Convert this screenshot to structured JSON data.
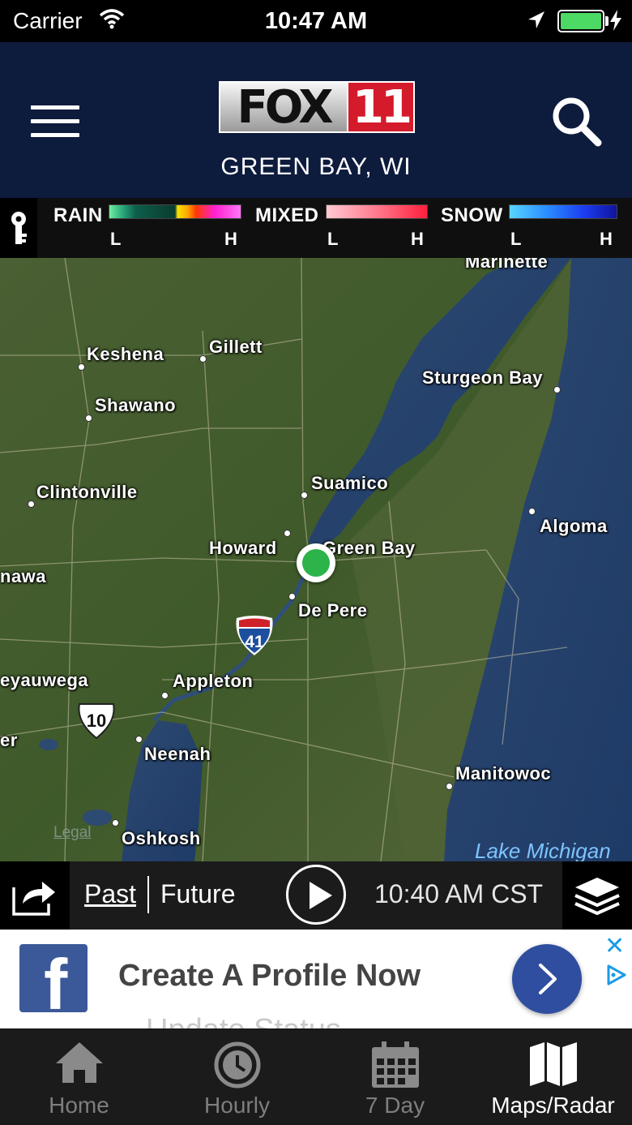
{
  "status_bar": {
    "carrier": "Carrier",
    "time": "10:47 AM",
    "battery_color": "#4cd964"
  },
  "header": {
    "logo_text": "FOX",
    "logo_number": "11",
    "location": "GREEN BAY, WI",
    "background_color": "#0d1b3d",
    "menu_icon": "hamburger-icon",
    "search_icon": "search-icon"
  },
  "legend": {
    "key_icon": "key-icon",
    "rain": {
      "label": "RAIN",
      "low": "L",
      "high": "H"
    },
    "mixed": {
      "label": "MIXED",
      "low": "L",
      "high": "H"
    },
    "snow": {
      "label": "SNOW",
      "low": "L",
      "high": "H"
    }
  },
  "map": {
    "cities": [
      {
        "name": "Marinette"
      },
      {
        "name": "Keshena"
      },
      {
        "name": "Gillett"
      },
      {
        "name": "Sturgeon Bay"
      },
      {
        "name": "Shawano"
      },
      {
        "name": "Suamico"
      },
      {
        "name": "Clintonville"
      },
      {
        "name": "Algoma"
      },
      {
        "name": "Howard"
      },
      {
        "name": "Green Bay"
      },
      {
        "name": "nawa"
      },
      {
        "name": "De Pere"
      },
      {
        "name": "eyauwega"
      },
      {
        "name": "Appleton"
      },
      {
        "name": "Neenah"
      },
      {
        "name": "Manitowoc"
      },
      {
        "name": "Oshkosh"
      },
      {
        "name": "er"
      }
    ],
    "highway_shields": [
      "41",
      "10"
    ],
    "water_label": "Lake Michigan",
    "legal": "Legal",
    "current_location_color": "#2cb34a"
  },
  "playback": {
    "share_icon": "share-icon",
    "past_label": "Past",
    "future_label": "Future",
    "play_icon": "play-icon",
    "frame_time": "10:40 AM CST",
    "layers_icon": "layers-icon"
  },
  "ad": {
    "logo_icon": "facebook-icon",
    "logo_letter": "f",
    "headline": "Create A Profile Now",
    "ghost_text": "Update Status",
    "cta_icon": "chevron-right-icon",
    "close_icon": "close-icon",
    "adchoices_icon": "adchoices-icon"
  },
  "tab_bar": {
    "tabs": [
      {
        "label": "Home",
        "icon": "home-icon",
        "active": false
      },
      {
        "label": "Hourly",
        "icon": "clock-icon",
        "active": false
      },
      {
        "label": "7 Day",
        "icon": "calendar-icon",
        "active": false
      },
      {
        "label": "Maps/Radar",
        "icon": "map-icon",
        "active": true
      }
    ]
  }
}
